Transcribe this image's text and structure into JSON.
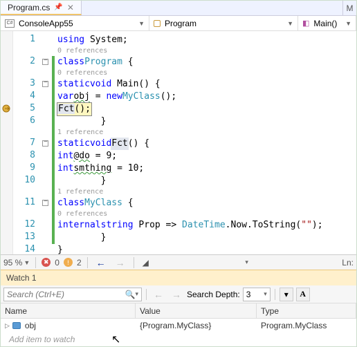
{
  "tab": {
    "title": "Program.cs",
    "pinned": true
  },
  "nav": {
    "project_icon_text": "C#",
    "project": "ConsoleApp55",
    "class": "Program",
    "member": "Main()"
  },
  "code": {
    "lines": [
      {
        "n": 1,
        "fold": false,
        "refs": null,
        "html": "<span class='kw'>using</span> System;",
        "indent": 0,
        "changed": false
      },
      {
        "n": null,
        "fold": false,
        "refs": "0 references",
        "indent": 1,
        "changed": false
      },
      {
        "n": 2,
        "fold": true,
        "refs": null,
        "html": "<span class='kw'>class</span> <span class='typ'>Program</span> {",
        "indent": 0,
        "changed": true
      },
      {
        "n": null,
        "fold": false,
        "refs": "0 references",
        "indent": 3,
        "changed": true
      },
      {
        "n": 3,
        "fold": true,
        "refs": null,
        "html": "<span class='kw'>static</span> <span class='kw'>void</span> Main() {",
        "indent": 2,
        "changed": true
      },
      {
        "n": 4,
        "fold": false,
        "refs": null,
        "html": "<span class='kw'>var</span> <span class='squig'>obj</span> = <span class='kw'>new</span> <span class='typ'>MyClass</span>();",
        "indent": 4,
        "changed": true
      },
      {
        "n": 5,
        "fold": false,
        "refs": null,
        "html": "<span class='hilite-stmt'><span class='hilite-sym'>Fct</span>();</span>",
        "indent": 4,
        "changed": true,
        "bp": true
      },
      {
        "n": 6,
        "fold": false,
        "refs": null,
        "html": "}",
        "indent": 2,
        "changed": true
      },
      {
        "n": null,
        "fold": false,
        "refs": "1 reference",
        "indent": 3,
        "changed": true
      },
      {
        "n": 7,
        "fold": true,
        "refs": null,
        "html": "<span class='kw'>static</span> <span class='kw'>void</span> <span class='hilite-sym'>Fct</span>() {",
        "indent": 2,
        "changed": true
      },
      {
        "n": 8,
        "fold": false,
        "refs": null,
        "html": "<span class='kw'>int</span> <span class='squig'>@do</span> = 9;",
        "indent": 4,
        "changed": true
      },
      {
        "n": 9,
        "fold": false,
        "refs": null,
        "html": "<span class='kw'>int</span> <span class='squig'>smthing</span> = 10;",
        "indent": 4,
        "changed": true
      },
      {
        "n": 10,
        "fold": false,
        "refs": null,
        "html": "}",
        "indent": 2,
        "changed": true
      },
      {
        "n": null,
        "fold": false,
        "refs": "1 reference",
        "indent": 3,
        "changed": true
      },
      {
        "n": 11,
        "fold": true,
        "refs": null,
        "html": "<span class='kw'>class</span> <span class='typ'>MyClass</span> {",
        "indent": 2,
        "changed": true
      },
      {
        "n": null,
        "fold": false,
        "refs": "0 references",
        "indent": 5,
        "changed": true
      },
      {
        "n": 12,
        "fold": false,
        "refs": null,
        "html": "<span class='kw'>internal</span> <span class='kw'>string</span> Prop =&gt; <span class='typ'>DateTime</span>.Now.ToString(<span class='str'>\"\"</span>);",
        "indent": 4,
        "changed": true
      },
      {
        "n": 13,
        "fold": false,
        "refs": null,
        "html": "}",
        "indent": 2,
        "changed": true
      },
      {
        "n": 14,
        "fold": false,
        "refs": null,
        "html": "}",
        "indent": 0,
        "changed": false
      }
    ]
  },
  "status": {
    "zoom": "95 %",
    "errors": "0",
    "warnings": "2",
    "ln_label": "Ln:"
  },
  "watch": {
    "title": "Watch 1",
    "search_placeholder": "Search (Ctrl+E)",
    "depth_label": "Search Depth:",
    "depth_value": "3",
    "cols": {
      "name": "Name",
      "value": "Value",
      "type": "Type"
    },
    "rows": [
      {
        "name": "obj",
        "value": "{Program.MyClass}",
        "type": "Program.MyClass"
      }
    ],
    "add_placeholder": "Add item to watch"
  }
}
